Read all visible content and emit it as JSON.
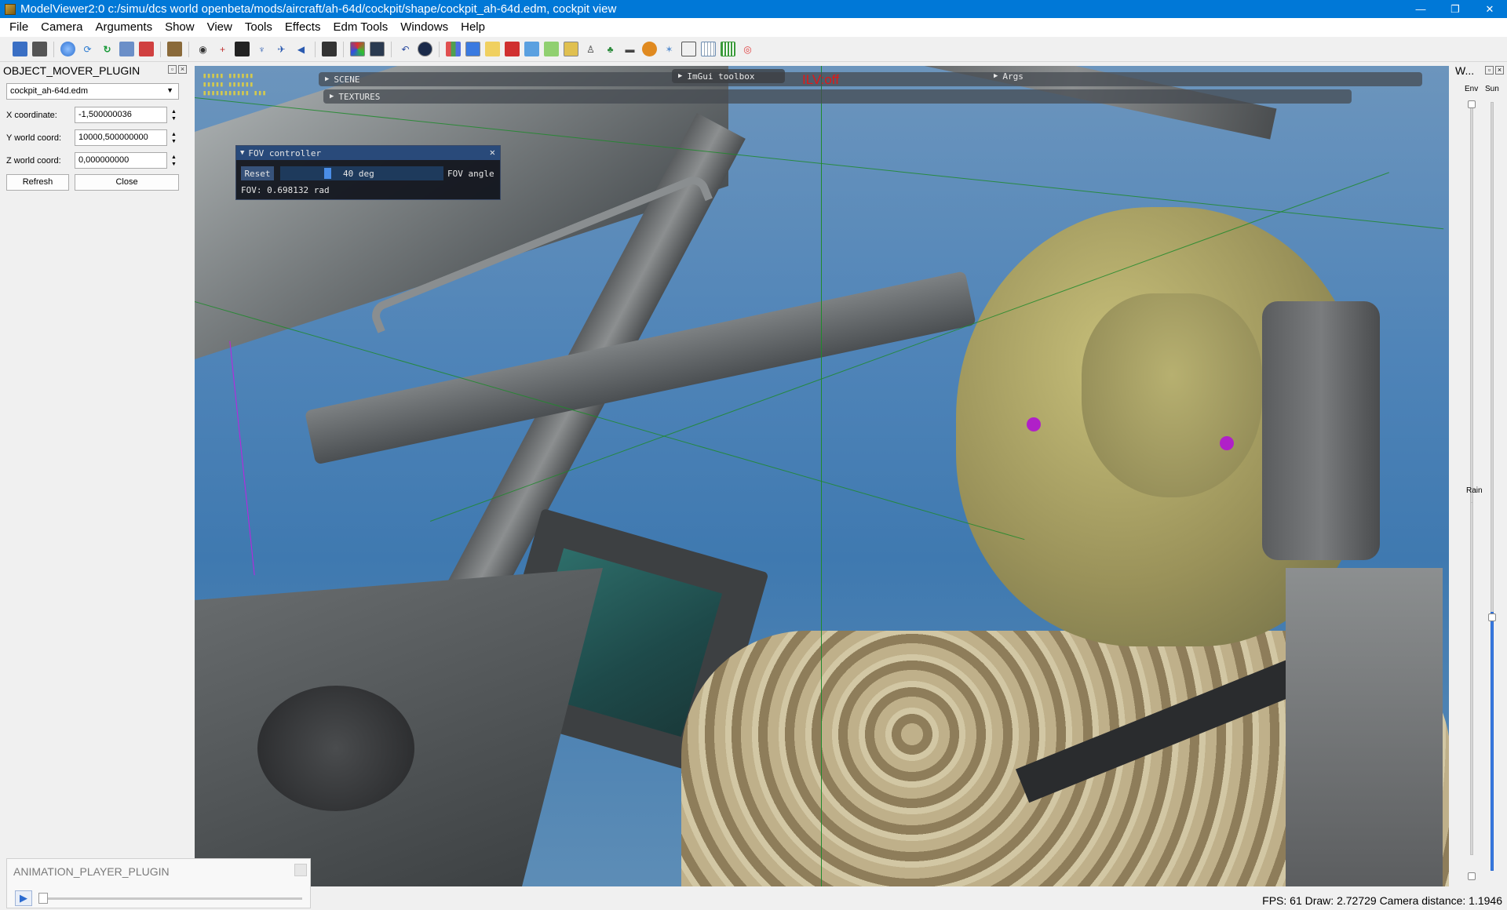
{
  "window": {
    "title": "ModelViewer2:0 c:/simu/dcs world openbeta/mods/aircraft/ah-64d/cockpit/shape/cockpit_ah-64d.edm, cockpit view",
    "minimize": "—",
    "maximize": "❐",
    "close": "✕"
  },
  "menu": [
    "File",
    "Camera",
    "Arguments",
    "Show",
    "View",
    "Tools",
    "Effects",
    "Edm Tools",
    "Windows",
    "Help"
  ],
  "toolbar_icons": [
    "save-icon",
    "export-icon",
    "sphere-icon",
    "refresh-icon",
    "reload-icon",
    "image-icon",
    "figure-icon",
    "box-icon",
    "camera-icon",
    "crosshair-icon",
    "grid-icon",
    "light-icon",
    "plane-icon",
    "arrow-icon",
    "screenshot-icon",
    "color-icon",
    "monitor-icon",
    "undo-icon",
    "record-icon",
    "chart-icon",
    "cube-icon",
    "folder-icon",
    "box-red-icon",
    "blue-icon",
    "green-icon",
    "yellow-icon",
    "person-icon",
    "tree-icon",
    "tank-icon",
    "sun-icon",
    "star-icon",
    "edit-icon",
    "table-icon",
    "grid-green-icon",
    "target-icon"
  ],
  "object_mover": {
    "title": "OBJECT_MOVER_PLUGIN",
    "model": "cockpit_ah-64d.edm",
    "x_label": "X coordinate:",
    "x_value": "-1,500000036",
    "y_label": "Y world coord:",
    "y_value": "10000,500000000",
    "z_label": "Z world coord:",
    "z_value": "0,000000000",
    "refresh": "Refresh",
    "close": "Close"
  },
  "viewport": {
    "scene": "SCENE",
    "textures": "TEXTURES",
    "imgui_toolbox": "ImGui toolbox",
    "args": "Args",
    "ilv": "ILV:off",
    "fov": {
      "title": "FOV controller",
      "reset": "Reset",
      "value": "40 deg",
      "label": "FOV angle",
      "rad": "FOV: 0.698132 rad"
    }
  },
  "right_dock": {
    "title": "W...",
    "env": "Env",
    "sun": "Sun",
    "rain": "Rain"
  },
  "animation_player": {
    "title": "ANIMATION_PLAYER_PLUGIN",
    "play": "▶"
  },
  "status": {
    "text": "FPS: 61  Draw: 2.72729  Camera distance: 1.1946"
  }
}
